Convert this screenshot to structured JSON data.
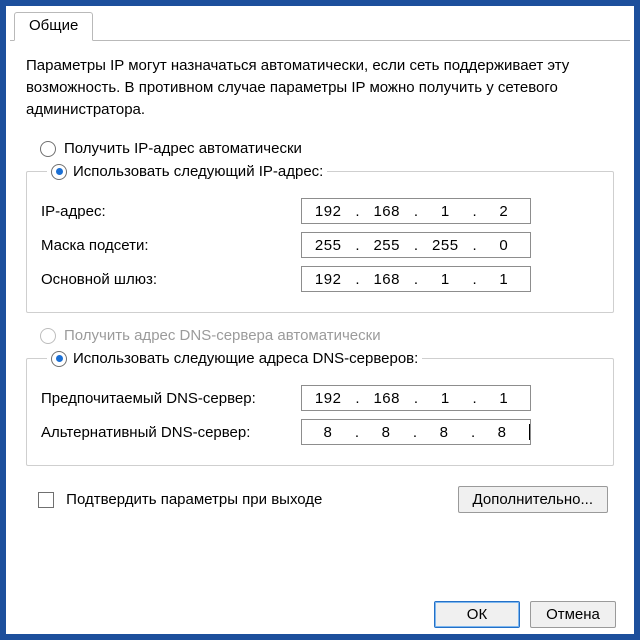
{
  "tab": {
    "general": "Общие"
  },
  "intro": "Параметры IP могут назначаться автоматически, если сеть поддерживает эту возможность. В противном случае параметры IP можно получить у сетевого администратора.",
  "ip": {
    "obtain_auto": "Получить IP-адрес автоматически",
    "use_following": "Использовать следующий IP-адрес:",
    "addr_label": "IP-адрес:",
    "mask_label": "Маска подсети:",
    "gw_label": "Основной шлюз:",
    "addr": [
      "192",
      "168",
      "1",
      "2"
    ],
    "mask": [
      "255",
      "255",
      "255",
      "0"
    ],
    "gw": [
      "192",
      "168",
      "1",
      "1"
    ]
  },
  "dns": {
    "obtain_auto": "Получить адрес DNS-сервера автоматически",
    "use_following": "Использовать следующие адреса DNS-серверов:",
    "pref_label": "Предпочитаемый DNS-сервер:",
    "alt_label": "Альтернативный DNS-сервер:",
    "pref": [
      "192",
      "168",
      "1",
      "1"
    ],
    "alt": [
      "8",
      "8",
      "8",
      "8"
    ]
  },
  "validate_on_exit": "Подтвердить параметры при выходе",
  "advanced": "Дополнительно...",
  "buttons": {
    "ok": "ОК",
    "cancel": "Отмена"
  }
}
